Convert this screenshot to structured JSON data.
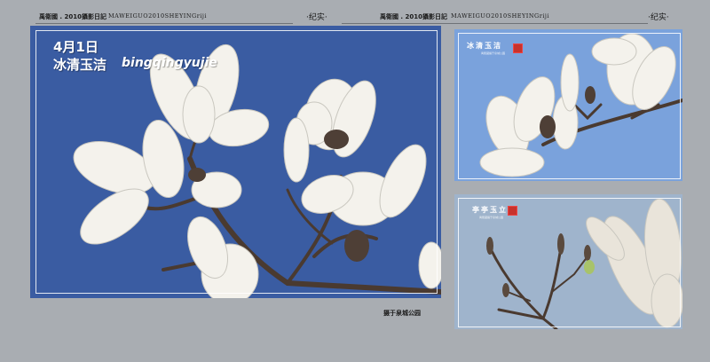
{
  "header": {
    "left_author": "禹衛國 . 2010攝影日記",
    "left_series": "MAWEIGUO2010SHEYINGriji",
    "left_tag": "·纪实·",
    "right_author": "禹衛國 . 2010攝影日記",
    "right_series": "MAWEIGUO2010SHEYINGriji",
    "right_tag": "·纪实·"
  },
  "main_photo": {
    "date_line": "4月1日",
    "title_cn": "冰清玉洁",
    "title_pinyin": "bingqingyujie"
  },
  "top_right_photo": {
    "title": "冰清玉洁",
    "subtitle": "禹衛國攝于泉城公園"
  },
  "bottom_right_photo": {
    "title": "亭亭玉立",
    "subtitle": "禹衛國攝于泉城公園"
  },
  "footer": {
    "location": "摄于泉城公园"
  },
  "colors": {
    "page_bg": "#a9adb2",
    "main_sky": "#3a5ca2",
    "side_sky": "#7aa2dc",
    "petal": "#f4f2ec",
    "branch": "#4a3a30"
  }
}
